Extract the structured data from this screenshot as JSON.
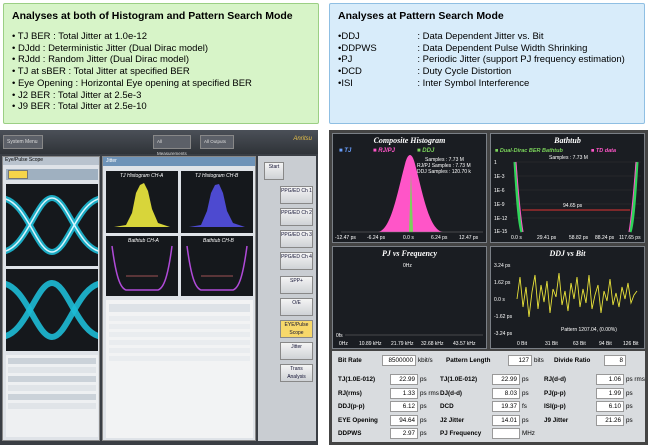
{
  "left_box": {
    "title": "Analyses at both of Histogram and Pattern Search Mode",
    "items": [
      "TJ BER : Total Jitter at 1.0e-12",
      "DJdd : Deterministic Jitter (Dual Dirac model)",
      "RJdd : Random Jitter (Dual Dirac model)",
      "TJ at sBER : Total Jitter at specified BER",
      "Eye Opening : Horizontal Eye opening at specified BER",
      "J2 BER : Total Jitter at 2.5e-3",
      "J9 BER : Total Jitter at 2.5e-10"
    ]
  },
  "right_box": {
    "title": "Analyses at Pattern Search Mode",
    "items": [
      {
        "key": "DDJ",
        "desc": ": Data Dependent Jitter vs. Bit"
      },
      {
        "key": "DDPWS",
        "desc": ": Data Dependent Pulse Width Shrinking"
      },
      {
        "key": "PJ",
        "desc": ": Periodic Jitter (support PJ frequency estimation)"
      },
      {
        "key": "DCD",
        "desc": ": Duty Cycle Distortion"
      },
      {
        "key": "ISI",
        "desc": ": Inter Symbol Interference"
      }
    ]
  },
  "shot1": {
    "system_menu": "System Menu",
    "all_measurements": "All Measurements",
    "all_outputs": "All Outputs",
    "brand": "Anritsu",
    "tab": "Eye/Pulse Scope",
    "jitter_label": "Jitter",
    "start": "Start",
    "hist_title": "TJ Histogram CH-A",
    "hist_title2": "TJ Histogram CH-B",
    "bathtub_a": "Bathtub CH-A",
    "bathtub_b": "Bathtub CH-B",
    "side_buttons": [
      "PPG/ED Ch 1",
      "PPG/ED Ch 2",
      "PPG/ED Ch 3",
      "PPG/ED Ch 4",
      "SPP+",
      "O/E",
      "EYE/Pulse Scope",
      "Jitter",
      "Trans Analysis"
    ]
  },
  "shot2": {
    "composite": {
      "title": "Composite Histogram",
      "legend": [
        "TJ",
        "RJ/PJ",
        "DDJ"
      ],
      "samples": "Samples : 7.73 M",
      "rjpj": "RJ/PJ Samples : 7.73 M",
      "ddj": "DDJ Samples : 120.70 k",
      "xticks": [
        "-12.47 ps",
        "-6.24 ps",
        "0.0 s",
        "6.24 ps",
        "12.47 ps"
      ]
    },
    "bathtub": {
      "title": "Bathtub",
      "legend": [
        "Dual-Dirac BER Bathtub",
        "TD data"
      ],
      "samples": "Samples : 7.73 M",
      "yticks": [
        "1",
        "1E-3",
        "1E-6",
        "1E-9",
        "1E-12",
        "1E-15"
      ],
      "xticks": [
        "0.0 s",
        "29.41 ps",
        "58.82 ps",
        "88.24 ps",
        "117.65 ps"
      ],
      "eye": "94.65 ps"
    },
    "pj": {
      "title": "PJ vs Frequency",
      "peak": "0Hz",
      "yticks": [
        "0fs"
      ],
      "xticks": [
        "0Hz",
        "10.89 kHz",
        "21.79 kHz",
        "32.68 kHz",
        "43.57 kHz"
      ]
    },
    "ddj": {
      "title": "DDJ vs Bit",
      "yticks": [
        "3.24 ps",
        "1.62 ps",
        "0.0 s",
        "-1.62 ps",
        "-3.24 ps"
      ],
      "xticks": [
        "0 Bit",
        "31 Bit",
        "63 Bit",
        "94 Bit",
        "126 Bit"
      ],
      "pattern": "Pattern 1207.04, (0.00%)"
    },
    "table": {
      "bit_rate_label": "Bit Rate",
      "bit_rate": "8500000",
      "bit_rate_unit": "kbit/s",
      "pattern_len_label": "Pattern Length",
      "pattern_len": "127",
      "pattern_len_unit": "bits",
      "divide_label": "Divide Ratio",
      "divide": "8",
      "rows": [
        [
          {
            "l": "TJ(1.0E-012)",
            "v": "22.99",
            "u": "ps"
          },
          {
            "l": "TJ(1.0E-012)",
            "v": "22.99",
            "u": "ps"
          },
          {
            "l": "RJ(d-d)",
            "v": "1.06",
            "u": "ps rms"
          }
        ],
        [
          {
            "l": "RJ(rms)",
            "v": "1.33",
            "u": "ps rms"
          },
          {
            "l": "DJ(d-d)",
            "v": "8.03",
            "u": "ps"
          },
          {
            "l": "PJ(p-p)",
            "v": "1.99",
            "u": "ps"
          }
        ],
        [
          {
            "l": "DDJ(p-p)",
            "v": "6.12",
            "u": "ps"
          },
          {
            "l": "DCD",
            "v": "19.37",
            "u": "fs"
          },
          {
            "l": "ISI(p-p)",
            "v": "6.10",
            "u": "ps"
          }
        ],
        [
          {
            "l": "EYE Opening",
            "v": "94.64",
            "u": "ps"
          },
          {
            "l": "J2 Jitter",
            "v": "14.01",
            "u": "ps"
          },
          {
            "l": "J9 Jitter",
            "v": "21.26",
            "u": "ps"
          }
        ],
        [
          {
            "l": "DDPWS",
            "v": "2.97",
            "u": "ps"
          },
          {
            "l": "PJ Frequency",
            "v": "",
            "u": "MHz"
          },
          {
            "l": "",
            "v": "",
            "u": ""
          }
        ]
      ]
    }
  }
}
